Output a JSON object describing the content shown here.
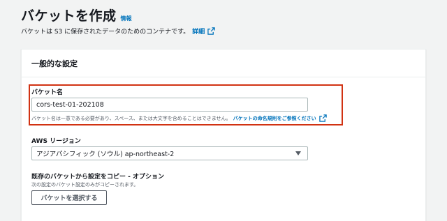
{
  "header": {
    "title": "バケットを作成",
    "info_label": "情報",
    "description": "バケットは S3 に保存されたデータのためのコンテナです。",
    "detail_link": "詳細"
  },
  "general_settings": {
    "panel_title": "一般的な設定",
    "bucket_name": {
      "label": "バケット名",
      "value": "cors-test-01-202108",
      "constraint_text": "バケット名は一意である必要があり、スペース、または大文字を含めることはできません。",
      "naming_link": "バケットの命名規則をご参照ください"
    },
    "region": {
      "label": "AWS リージョン",
      "selected": "アジアパシフィック (ソウル) ap-northeast-2"
    },
    "copy_settings": {
      "label": "既存のバケットから設定をコピー - オプション",
      "description": "次の設定のバケット設定のみがコピーされます。",
      "button_label": "バケットを選択する"
    }
  },
  "colors": {
    "link": "#0073bb",
    "highlight_border": "#d13212",
    "background": "#f2f3f3"
  },
  "icons": {
    "external_link": "external-link-icon",
    "dropdown": "caret-down-icon"
  }
}
